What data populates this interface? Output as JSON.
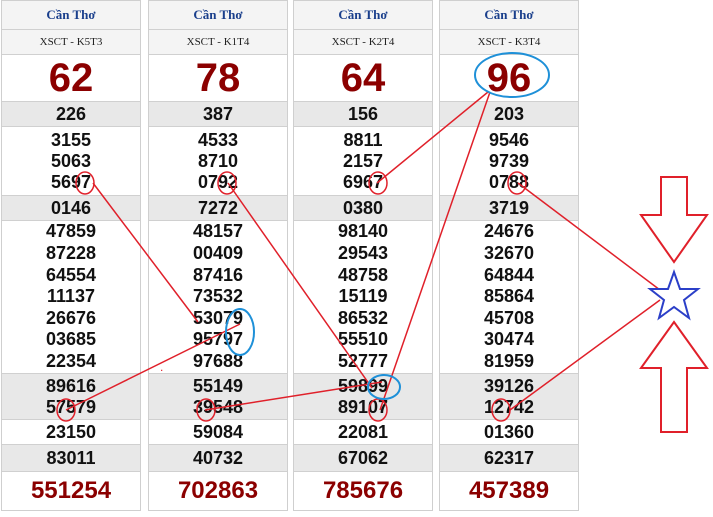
{
  "columns": [
    {
      "province": "Cần Thơ",
      "code": "XSCT - K5T3",
      "g8": "62",
      "g7": "226",
      "g6": [
        "3155",
        "5063",
        "5697"
      ],
      "g5": "0146",
      "g4": [
        "47859",
        "87228",
        "64554",
        "11137",
        "26676",
        "03685",
        "22354"
      ],
      "g3": [
        "89616",
        "57579"
      ],
      "g2": "23150",
      "g1": "83011",
      "special": "551254"
    },
    {
      "province": "Cần Thơ",
      "code": "XSCT - K1T4",
      "g8": "78",
      "g7": "387",
      "g6": [
        "4533",
        "8710",
        "0792"
      ],
      "g5": "7272",
      "g4": [
        "48157",
        "00409",
        "87416",
        "73532",
        "53079",
        "95797",
        "97688"
      ],
      "g3": [
        "55149",
        "39548"
      ],
      "g2": "59084",
      "g1": "40732",
      "special": "702863"
    },
    {
      "province": "Cần Thơ",
      "code": "XSCT - K2T4",
      "g8": "64",
      "g7": "156",
      "g6": [
        "8811",
        "2157",
        "6967"
      ],
      "g5": "0380",
      "g4": [
        "98140",
        "29543",
        "48758",
        "15119",
        "86532",
        "55510",
        "52777"
      ],
      "g3": [
        "59899",
        "89107"
      ],
      "g2": "22081",
      "g1": "67062",
      "special": "785676"
    },
    {
      "province": "Cần Thơ",
      "code": "XSCT - K3T4",
      "g8": "96",
      "g7": "203",
      "g6": [
        "9546",
        "9739",
        "0788"
      ],
      "g5": "3719",
      "g4": [
        "24676",
        "32670",
        "64844",
        "85864",
        "45708",
        "30474",
        "81959"
      ],
      "g3": [
        "39126",
        "12742"
      ],
      "g2": "01360",
      "g1": "62317",
      "special": "457389"
    }
  ],
  "colors": {
    "header_text": "#1a3f8c",
    "prize_red": "#8b0000",
    "annotation_red": "#e0202a",
    "annotation_blue": "#1e90d8",
    "star_blue": "#2b3fc8"
  }
}
